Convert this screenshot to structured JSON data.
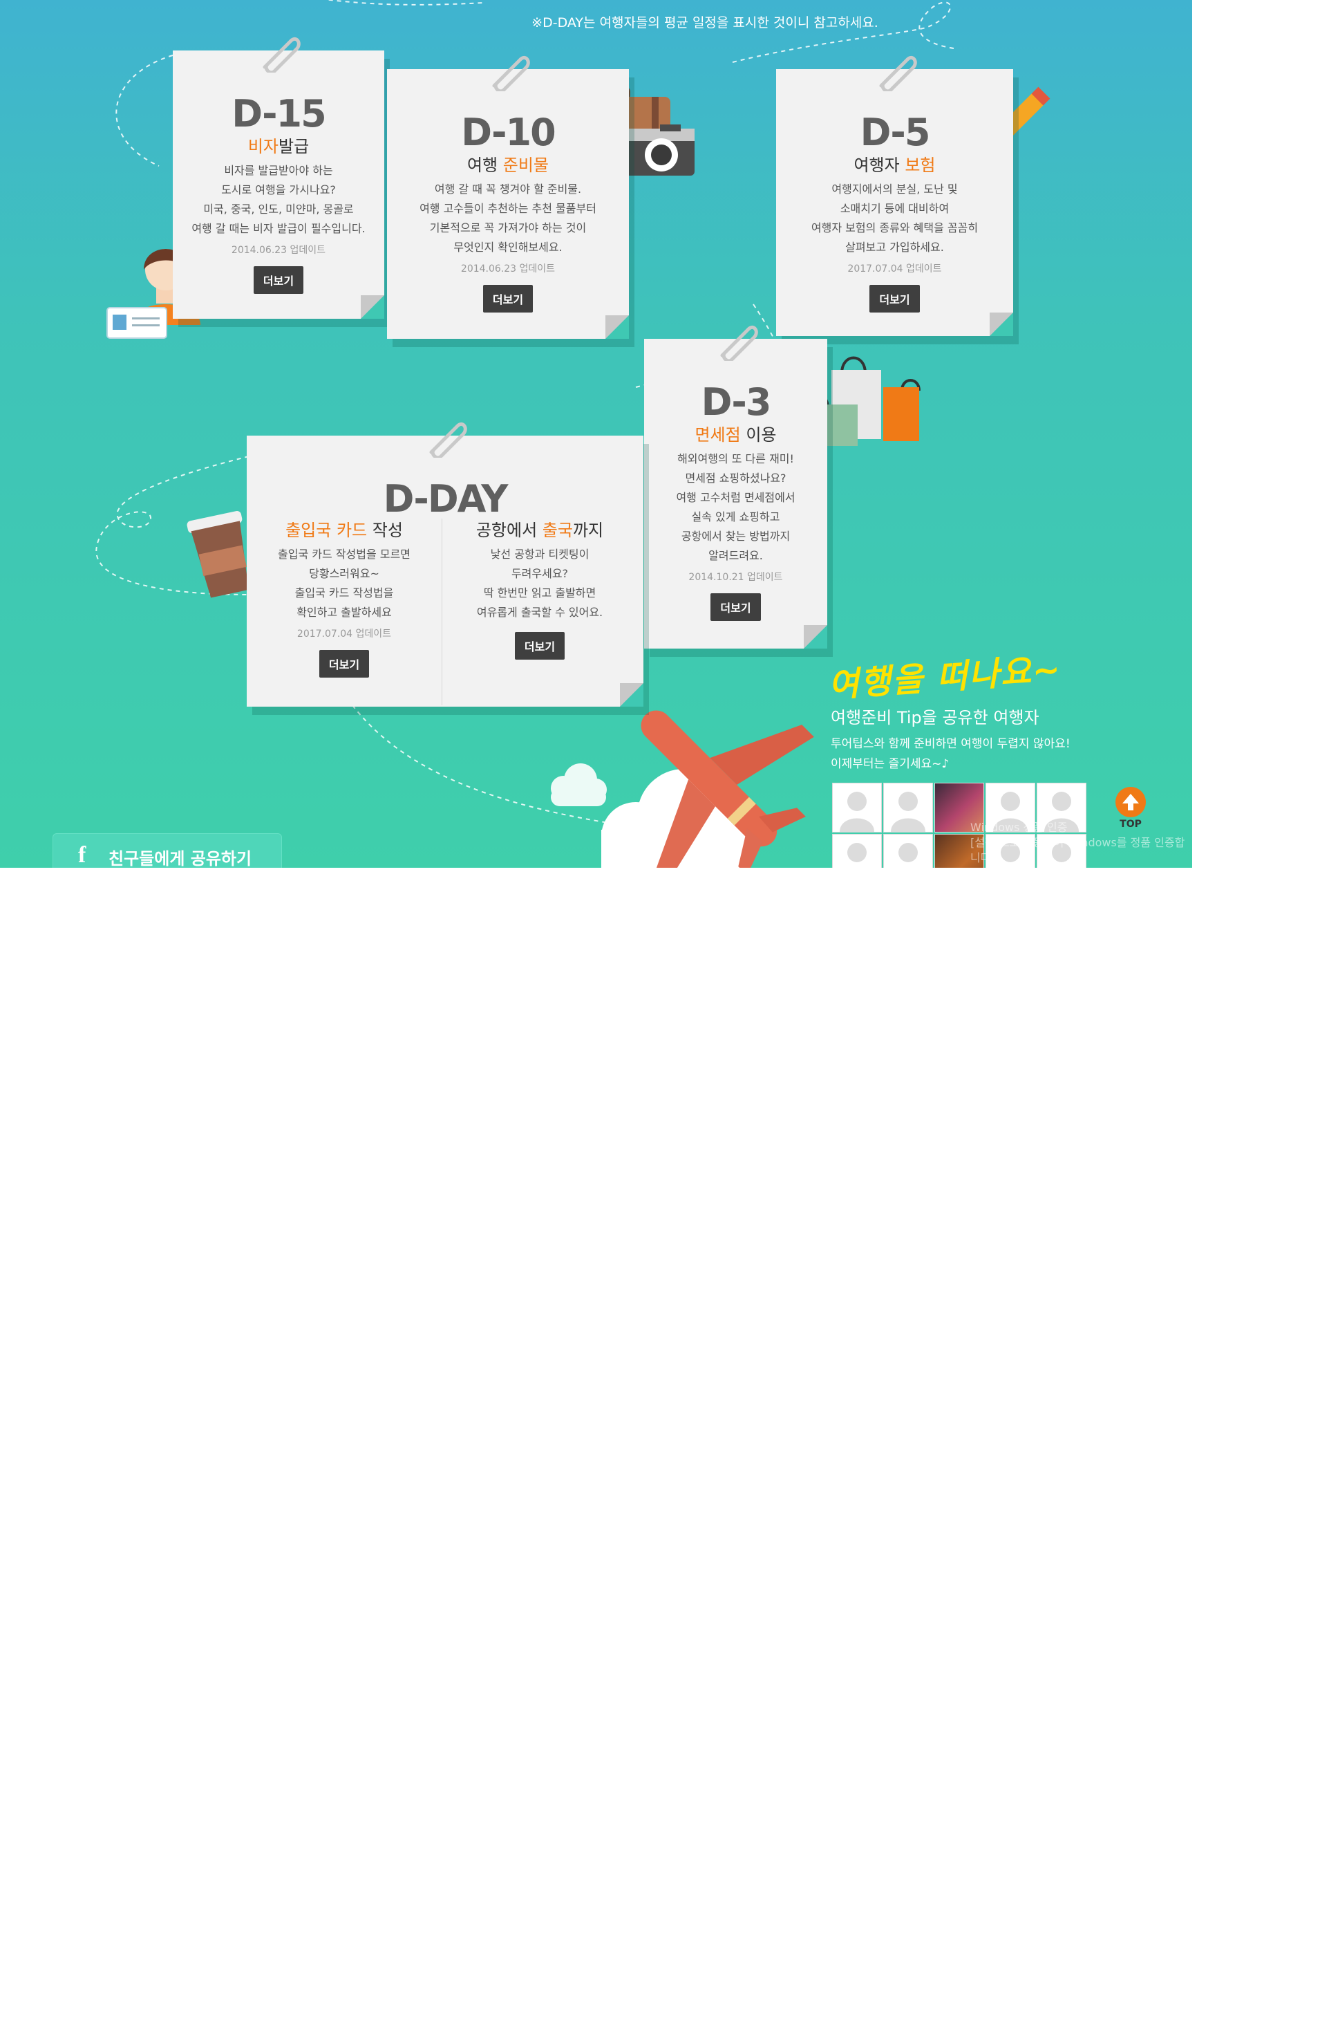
{
  "notice": "※D-DAY는 여행자들의 평균 일정을 표시한 것이니 참고하세요.",
  "colors": {
    "accent": "#f07a16",
    "teal_top": "#40b3d0",
    "teal_bottom": "#3fcfab",
    "button": "#3f3f3f"
  },
  "cards": {
    "d15": {
      "label": "D-15",
      "title_hl": "비자",
      "title_rest": "발급",
      "desc": [
        "비자를 발급받아야 하는",
        "도시로 여행을 가시나요?",
        "미국, 중국, 인도, 미얀마, 몽골로",
        "여행 갈 때는 비자 발급이 필수입니다."
      ],
      "date": "2014.06.23 업데이트",
      "button": "더보기"
    },
    "d10": {
      "label": "D-10",
      "title_pre": "여행 ",
      "title_hl": "준비물",
      "desc": [
        "여행 갈 때 꼭 챙겨야 할 준비물.",
        "여행 고수들이 추천하는 추천 물품부터",
        "기본적으로 꼭 가져가야 하는 것이",
        "무엇인지 확인해보세요."
      ],
      "date": "2014.06.23 업데이트",
      "button": "더보기"
    },
    "d5": {
      "label": "D-5",
      "title_pre": "여행자 ",
      "title_hl": "보험",
      "desc": [
        "여행지에서의 분실, 도난 및",
        "소매치기 등에 대비하여",
        "여행자 보험의 종류와 혜택을 꼼꼼히",
        "살펴보고 가입하세요."
      ],
      "date": "2017.07.04 업데이트",
      "button": "더보기"
    },
    "d3": {
      "label": "D-3",
      "title_hl": "면세점",
      "title_rest": " 이용",
      "desc": [
        "해외여행의 또 다른 재미!",
        "면세점 쇼핑하셨나요?",
        "여행 고수처럼 면세점에서",
        "실속 있게 쇼핑하고",
        "공항에서 찾는 방법까지",
        "알려드려요."
      ],
      "date": "2014.10.21 업데이트",
      "button": "더보기"
    },
    "dday": {
      "label": "D-DAY",
      "left": {
        "title_hl": "출입국 카드",
        "title_rest": " 작성",
        "desc": [
          "출입국 카드 작성법을 모르면",
          "당황스러워요~",
          "출입국 카드 작성법을",
          "확인하고 출발하세요"
        ],
        "date": "2017.07.04 업데이트",
        "button": "더보기"
      },
      "right": {
        "title_pre": "공항에서 ",
        "title_hl": "출국",
        "title_rest": "까지",
        "desc": [
          "낯선 공항과 티켓팅이",
          "두려우세요?",
          "딱 한번만 읽고 출발하면",
          "여유롭게 출국할 수 있어요."
        ],
        "button": "더보기"
      }
    }
  },
  "travelers": {
    "heading": "여행을 떠나요~",
    "subtitle": "여행준비 Tip을 공유한 여행자",
    "desc": [
      "투어팁스와 함께 준비하면 여행이 두렵지 않아요!",
      "이제부터는 즐기세요~♪"
    ],
    "avatars": [
      "default",
      "default",
      "photo",
      "default",
      "default",
      "default",
      "default",
      "photo2",
      "default",
      "default"
    ]
  },
  "top_button": "TOP",
  "watermark": [
    "Windows 정품 인증",
    "[설정]으로 이동하여 Windows를 정품 인증합니다."
  ],
  "share_button": "친구들에게 공유하기",
  "icons": [
    "paperclip-icon",
    "person-icon",
    "id-card-icon",
    "suitcase-icon",
    "camera-icon",
    "pencil-icon",
    "shopping-bags-icon",
    "coffee-cup-icon",
    "airplane-icon",
    "cloud-icon",
    "arrow-up-icon",
    "facebook-icon"
  ]
}
